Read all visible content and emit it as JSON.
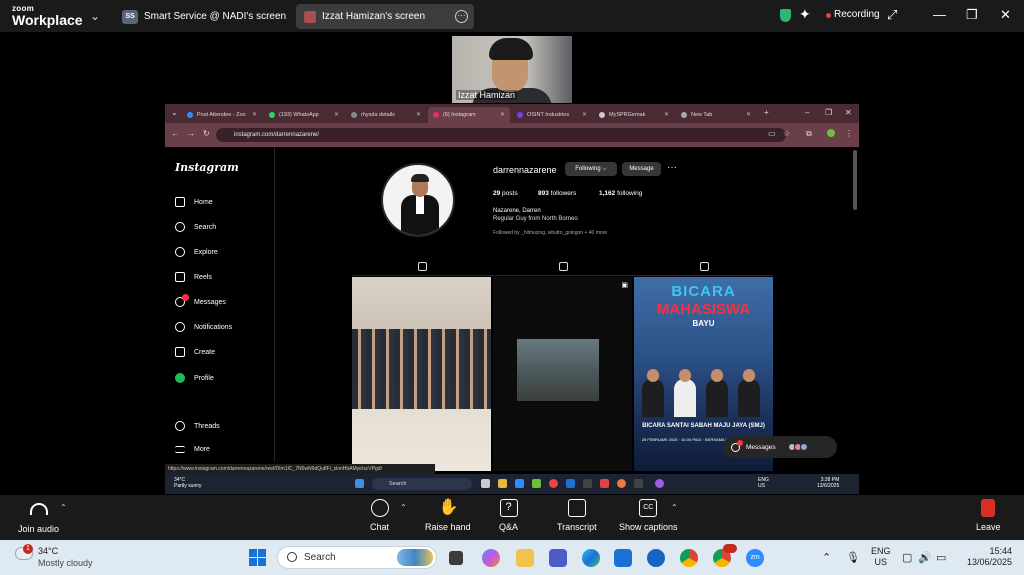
{
  "zoom": {
    "logo_small": "zoom",
    "logo_big": "Workplace",
    "tabs": [
      {
        "badge": "SS",
        "label": "Smart Service @ NADI's screen"
      },
      {
        "label": "Izzat Hamizan's screen"
      }
    ],
    "recording_label": "Recording",
    "participant_name": "Izzat Hamizan",
    "controls": {
      "join_audio": "Join audio",
      "chat": "Chat",
      "raise_hand": "Raise hand",
      "qa": "Q&A",
      "transcript": "Transcript",
      "show_captions": "Show captions",
      "leave": "Leave"
    }
  },
  "browser": {
    "tabs": [
      {
        "label": "Post Attendee - Zoo",
        "color": "#2d8cff"
      },
      {
        "label": "(193) WhatsApp",
        "color": "#25d366"
      },
      {
        "label": "rhysda details",
        "color": "#888888"
      },
      {
        "label": "(6) Instagram",
        "color": "#e1306c"
      },
      {
        "label": "OSINT Industries",
        "color": "#7b3fe4"
      },
      {
        "label": "MySPRGemak",
        "color": "#cccccc"
      },
      {
        "label": "New Tab",
        "color": "#aaaaaa"
      }
    ],
    "url": "instagram.com/darrennazarene/",
    "status_url": "https://www.instagram.com/darrennazarene/reel/DIm1IC_7N0wN9dQu8Fi_skmHbAMyeIxcVPgd/"
  },
  "instagram": {
    "logo": "Instagram",
    "nav": [
      "Home",
      "Search",
      "Explore",
      "Reels",
      "Messages",
      "Notifications",
      "Create",
      "Profile",
      "Threads",
      "More"
    ],
    "username": "darrennazarene",
    "following_label": "Following ⌵",
    "message_label": "Message",
    "posts_count": "29",
    "posts_label": "posts",
    "followers_count": "893",
    "followers_label": "followers",
    "following_count": "1,162",
    "following_stat_label": "following",
    "full_name": "Nazarene, Darren",
    "bio": "Regular Guy from North Borneo",
    "followed_by": "Followed by _hilmuzing, whutto_goingon + 40 more",
    "post3": {
      "title1": "BICARA",
      "title2": "MAHASISWA",
      "title3": "BAYU",
      "bottom1": "BICARA SANTAI SABAH MAJU JAYA (SMJ)",
      "bottom2": "25 FEBRUARI 2025 · 10.00 PAGI · BERSAMA LANGKAH BERSAMA"
    },
    "messages_label": "Messages"
  },
  "inner_taskbar": {
    "temp": "34°C",
    "condition": "Partly sunny",
    "search": "Search",
    "lang": "ENG",
    "lang2": "US",
    "time": "3:38 PM",
    "date": "13/6/2025"
  },
  "taskbar": {
    "weather_badge": "1",
    "temp": "34°C",
    "condition": "Mostly cloudy",
    "search": "Search",
    "lang": "ENG",
    "lang2": "US",
    "time": "15:44",
    "date": "13/06/2025"
  }
}
